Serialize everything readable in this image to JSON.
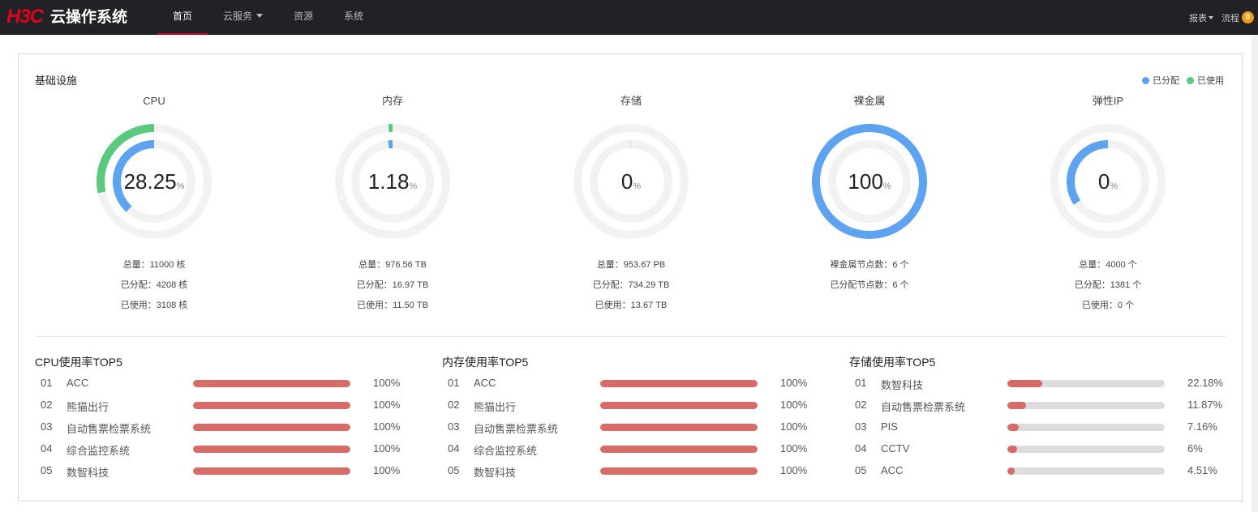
{
  "header": {
    "logo_mark": "H3C",
    "logo_text": "云操作系统",
    "nav": [
      {
        "label": "首页",
        "active": true
      },
      {
        "label": "云服务",
        "dropdown": true
      },
      {
        "label": "资源"
      },
      {
        "label": "系统"
      }
    ],
    "right": {
      "reports_label": "报表",
      "workflow_label": "流程",
      "workflow_badge": "0"
    }
  },
  "colors": {
    "allocated": "#5ea3ef",
    "used": "#5bc97d",
    "track": "#f2f2f2",
    "top_bar": "#d76b67",
    "brand": "#e1001a"
  },
  "infra": {
    "title": "基础设施",
    "legend": {
      "allocated": "已分配",
      "used": "已使用"
    },
    "gauges": [
      {
        "title": "CPU",
        "value": "28.25",
        "unit": "%",
        "allocated_fraction": 0.3825,
        "used_fraction": 0.2825,
        "stats": [
          "总量：11000 核",
          "已分配：4208 核",
          "已使用：3108 核"
        ]
      },
      {
        "title": "内存",
        "value": "1.18",
        "unit": "%",
        "allocated_fraction": 0.0174,
        "used_fraction": 0.0118,
        "stats": [
          "总量：976.56 TB",
          "已分配：16.97 TB",
          "已使用：11.50 TB"
        ]
      },
      {
        "title": "存储",
        "value": "0",
        "unit": "%",
        "allocated_fraction": 0.0008,
        "used_fraction": 0.0,
        "stats": [
          "总量：953.67 PB",
          "已分配：734.29 TB",
          "已使用：13.67 TB"
        ]
      },
      {
        "title": "裸金属",
        "value": "100",
        "unit": "%",
        "allocated_fraction": 1.0,
        "used_fraction": 0.0,
        "stats": [
          "裸金属节点数：6 个",
          "已分配节点数：6 个"
        ]
      },
      {
        "title": "弹性IP",
        "value": "0",
        "unit": "%",
        "allocated_fraction": 0.3453,
        "used_fraction": 0.0,
        "stats": [
          "总量：4000 个",
          "已分配：1381 个",
          "已使用：0 个"
        ]
      }
    ]
  },
  "top5": [
    {
      "title": "CPU使用率TOP5",
      "rows": [
        {
          "rank": "01",
          "name": "ACC",
          "value": 100,
          "label": "100%"
        },
        {
          "rank": "02",
          "name": "熊猫出行",
          "value": 100,
          "label": "100%"
        },
        {
          "rank": "03",
          "name": "自动售票检票系统",
          "value": 100,
          "label": "100%"
        },
        {
          "rank": "04",
          "name": "综合监控系统",
          "value": 100,
          "label": "100%"
        },
        {
          "rank": "05",
          "name": "数智科技",
          "value": 100,
          "label": "100%"
        }
      ]
    },
    {
      "title": "内存使用率TOP5",
      "rows": [
        {
          "rank": "01",
          "name": "ACC",
          "value": 100,
          "label": "100%"
        },
        {
          "rank": "02",
          "name": "熊猫出行",
          "value": 100,
          "label": "100%"
        },
        {
          "rank": "03",
          "name": "自动售票检票系统",
          "value": 100,
          "label": "100%"
        },
        {
          "rank": "04",
          "name": "综合监控系统",
          "value": 100,
          "label": "100%"
        },
        {
          "rank": "05",
          "name": "数智科技",
          "value": 100,
          "label": "100%"
        }
      ]
    },
    {
      "title": "存储使用率TOP5",
      "rows": [
        {
          "rank": "01",
          "name": "数智科技",
          "value": 22.18,
          "label": "22.18%"
        },
        {
          "rank": "02",
          "name": "自动售票检票系统",
          "value": 11.87,
          "label": "11.87%"
        },
        {
          "rank": "03",
          "name": "PIS",
          "value": 7.16,
          "label": "7.16%"
        },
        {
          "rank": "04",
          "name": "CCTV",
          "value": 6,
          "label": "6%"
        },
        {
          "rank": "05",
          "name": "ACC",
          "value": 4.51,
          "label": "4.51%"
        }
      ]
    }
  ]
}
